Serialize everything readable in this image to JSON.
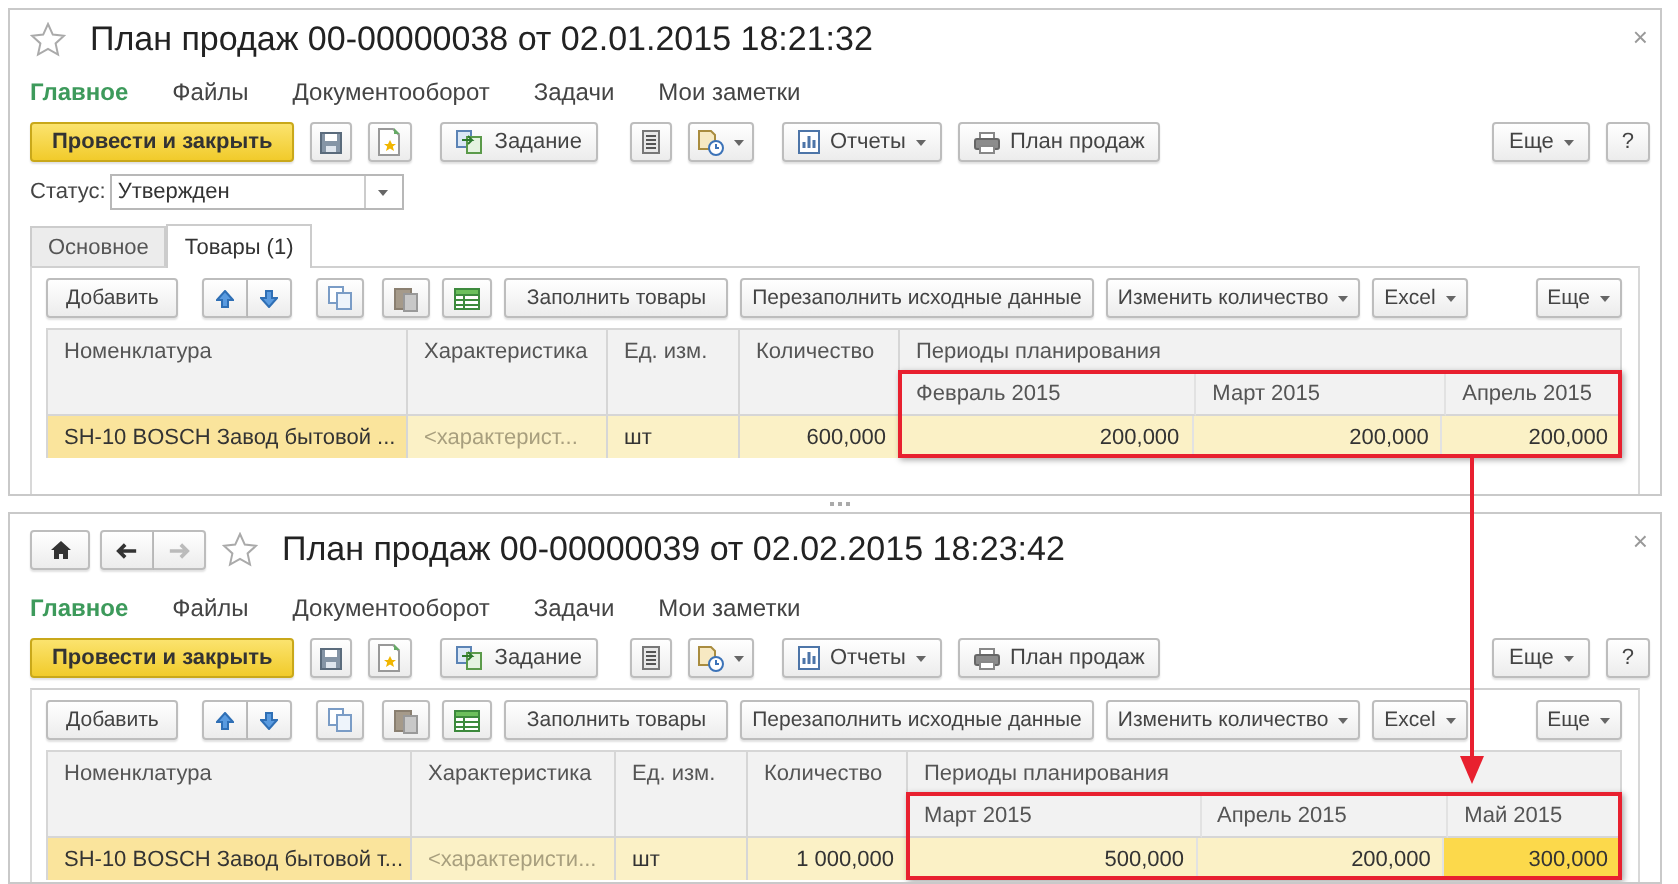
{
  "windows": [
    {
      "title": "План продаж 00-00000038 от 02.01.2015 18:21:32",
      "close": "×",
      "menu": [
        {
          "label": "Главное",
          "selected": true
        },
        {
          "label": "Файлы",
          "selected": false
        },
        {
          "label": "Документооборот",
          "selected": false
        },
        {
          "label": "Задачи",
          "selected": false
        },
        {
          "label": "Мои заметки",
          "selected": false
        }
      ],
      "toolbar": {
        "post_button": "Провести и закрыть",
        "task_button": "Задание",
        "reports_menu": "Отчеты",
        "print_button": "План продаж",
        "more_menu": "Еще",
        "help_button": "?"
      },
      "status": {
        "label": "Статус:",
        "value": "Утвержден"
      },
      "tabs": [
        {
          "label": "Основное",
          "selected": false
        },
        {
          "label": "Товары (1)",
          "selected": true
        }
      ],
      "table_toolbar": {
        "add_button": "Добавить",
        "fill_button": "Заполнить товары",
        "refill_button": "Перезаполнить исходные данные",
        "change_quantity_menu": "Изменить количество",
        "excel_menu": "Excel",
        "more_menu": "Еще"
      },
      "table": {
        "columns": [
          "Номенклатура",
          "Характеристика",
          "Ед. изм.",
          "Количество"
        ],
        "period_group": "Периоды планирования",
        "periods": [
          "Февраль 2015",
          "Март 2015",
          "Апрель 2015"
        ],
        "period_frame": true,
        "rows": [
          {
            "selected": true,
            "nomenclature": "SH-10 BOSCH Завод бытовой ...",
            "characteristic_placeholder": "<характерист...",
            "unit": "шт",
            "quantity": "600,000",
            "values": [
              {
                "value": "200,000",
                "selected": false
              },
              {
                "value": "200,000",
                "selected": false
              },
              {
                "value": "200,000",
                "selected": false
              }
            ]
          }
        ]
      }
    },
    {
      "navigation": {
        "back_enabled": true,
        "forward_enabled": false
      },
      "title": "План продаж 00-00000039 от 02.02.2015 18:23:42",
      "close": "×",
      "menu": [
        {
          "label": "Главное",
          "selected": true
        },
        {
          "label": "Файлы",
          "selected": false
        },
        {
          "label": "Документооборот",
          "selected": false
        },
        {
          "label": "Задачи",
          "selected": false
        },
        {
          "label": "Мои заметки",
          "selected": false
        }
      ],
      "toolbar": {
        "post_button": "Провести и закрыть",
        "task_button": "Задание",
        "reports_menu": "Отчеты",
        "print_button": "План продаж",
        "more_menu": "Еще",
        "help_button": "?"
      },
      "table_toolbar": {
        "add_button": "Добавить",
        "fill_button": "Заполнить товары",
        "refill_button": "Перезаполнить исходные данные",
        "change_quantity_menu": "Изменить количество",
        "excel_menu": "Excel",
        "more_menu": "Еще"
      },
      "table": {
        "columns": [
          "Номенклатура",
          "Характеристика",
          "Ед. изм.",
          "Количество"
        ],
        "period_group": "Периоды планирования",
        "periods": [
          "Март 2015",
          "Апрель 2015",
          "Май 2015"
        ],
        "period_frame": true,
        "rows": [
          {
            "selected": true,
            "nomenclature": "SH-10 BOSCH Завод бытовой т...",
            "characteristic_placeholder": "<характеристи...",
            "unit": "шт",
            "quantity": "1 000,000",
            "values": [
              {
                "value": "500,000",
                "selected": false
              },
              {
                "value": "200,000",
                "selected": false
              },
              {
                "value": "300,000",
                "selected": true
              }
            ]
          }
        ]
      }
    }
  ],
  "arrow": true
}
